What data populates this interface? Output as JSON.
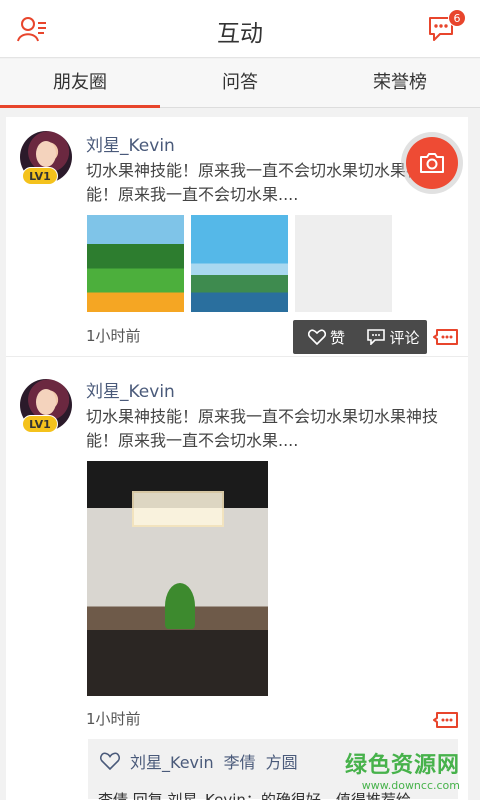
{
  "header": {
    "title": "互动",
    "message_badge": "6"
  },
  "tabs": [
    {
      "label": "朋友圈",
      "active": true
    },
    {
      "label": "问答",
      "active": false
    },
    {
      "label": "荣誉榜",
      "active": false
    }
  ],
  "posts": [
    {
      "username": "刘星_Kevin",
      "level": "LV1",
      "content": "切水果神技能！原来我一直不会切水果切水果神技能！原来我一直不会切水果....",
      "time": "1小时前",
      "images": [
        "forest",
        "island",
        "blank"
      ],
      "actions": {
        "like": "赞",
        "comment": "评论"
      }
    },
    {
      "username": "刘星_Kevin",
      "level": "LV1",
      "content": "切水果神技能！原来我一直不会切水果切水果神技能！原来我一直不会切水果....",
      "time": "1小时前",
      "likers": [
        "刘星_Kevin",
        "李倩",
        "方圆"
      ],
      "comment_preview": "李倩 回复 刘星_Kevin：的确很好，值得推荐给"
    }
  ],
  "watermark": {
    "title": "绿色资源网",
    "url": "www.downcc.com"
  },
  "colors": {
    "accent": "#e8452c",
    "username": "#4a5a7a",
    "level_badge": "#f4c21c",
    "watermark": "#47b24b"
  }
}
